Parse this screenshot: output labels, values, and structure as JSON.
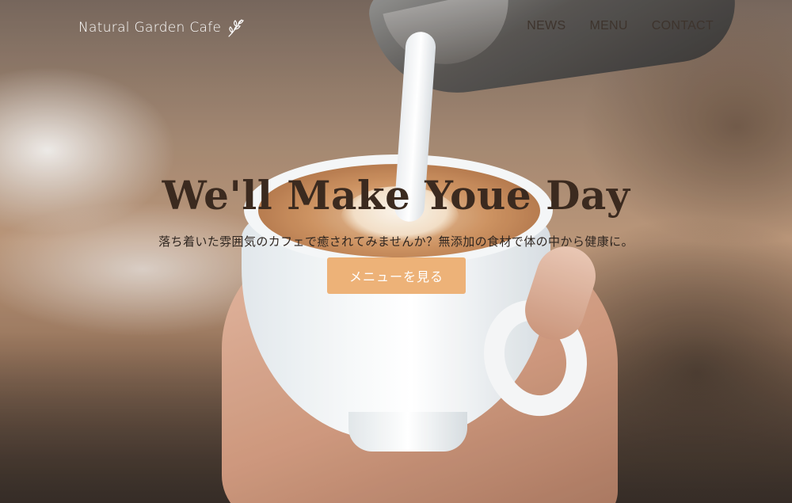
{
  "header": {
    "logo_text": "Natural Garden Cafe",
    "logo_icon": "leaf-icon",
    "nav": [
      {
        "label": "NEWS"
      },
      {
        "label": "MENU"
      },
      {
        "label": "CONTACT"
      }
    ]
  },
  "hero": {
    "headline": "We'll Make Youe Day",
    "subtext": "落ち着いた雰囲気のカフェで癒されてみませんか？無添加の食材で体の中から健康に。",
    "cta_label": "メニューを見る"
  },
  "colors": {
    "cta_background": "#edb278",
    "headline_text": "#3b2a1f",
    "nav_text": "#3e342d",
    "logo_text": "#ffffff"
  }
}
